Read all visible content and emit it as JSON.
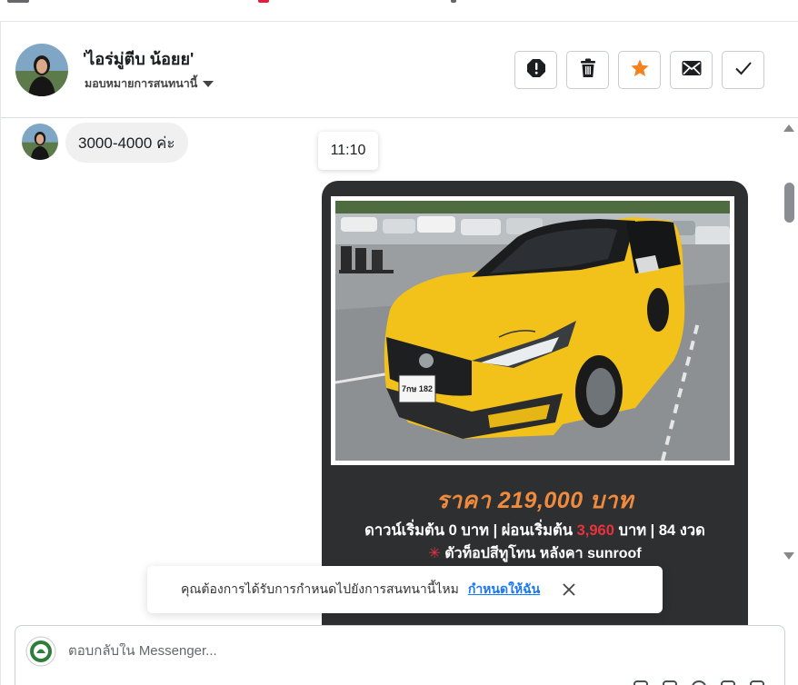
{
  "contact": {
    "name": "'ไอร่มู่ตีบ น้อยย'",
    "assign_label": "มอบหมายการสนทนานี้"
  },
  "header_actions": [
    {
      "icon": "alert-icon",
      "label": "Mark as spam"
    },
    {
      "icon": "trash-icon",
      "label": "Delete"
    },
    {
      "icon": "star-icon",
      "label": "Star",
      "color": "#f5821f"
    },
    {
      "icon": "mail-icon",
      "label": "Mark as unread"
    },
    {
      "icon": "check-icon",
      "label": "Mark as done"
    }
  ],
  "messages": {
    "incoming_text": "3000-4000 ค่ะ",
    "timestamp": "11:10"
  },
  "ad_card": {
    "plate": "7กษ 182",
    "price_line": "ราคา 219,000 บาท",
    "terms_prefix": "ดาวน์เริ่มต้น 0 บาท | ผ่อนเริ่มต้น ",
    "terms_highlight": "3,960",
    "terms_suffix": " บาท | 84 งวด",
    "feature_star": "✳",
    "feature_text": " ตัวท็อปสีทูโทน หลังคา sunroof",
    "colors": {
      "price": "#f08a3c",
      "highlight": "#e8333d",
      "card_bg": "#2d2f31"
    }
  },
  "toast": {
    "text": "คุณต้องการได้รับการกำหนดไปยังการสนทนานี้ไหม",
    "link": "กำหนดให้ฉัน"
  },
  "reply": {
    "placeholder": "ตอบกลับใน Messenger..."
  },
  "colors": {
    "accent": "#1877f2",
    "star": "#f5821f"
  }
}
